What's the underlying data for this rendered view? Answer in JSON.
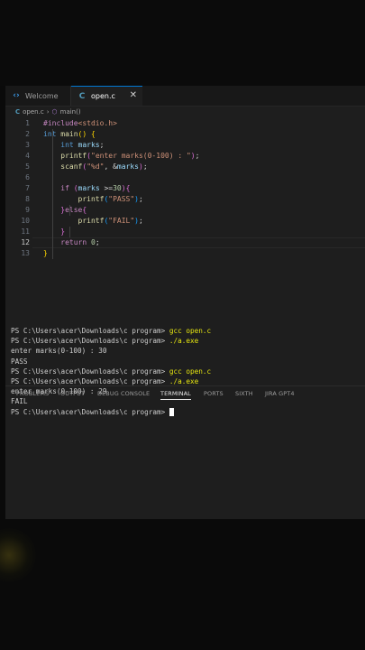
{
  "tabs": [
    {
      "label": "Welcome",
      "icon": "vscode-icon"
    },
    {
      "label": "open.c",
      "icon": "c-file-icon",
      "active": true
    }
  ],
  "breadcrumb": {
    "file": "open.c",
    "symbol": "main()"
  },
  "code_lines": [
    {
      "n": "1",
      "tokens": [
        [
          "#include",
          "k-pink"
        ],
        [
          "<stdio.h>",
          "k-str"
        ]
      ]
    },
    {
      "n": "2",
      "tokens": [
        [
          "int ",
          "k-blue"
        ],
        [
          "main",
          "k-yel"
        ],
        [
          "() ",
          "b1"
        ],
        [
          "{",
          "b1"
        ]
      ]
    },
    {
      "n": "3",
      "tokens": [
        [
          "    "
        ],
        [
          "int ",
          "k-blue"
        ],
        [
          "marks",
          "k-var"
        ],
        [
          ";",
          "k-punc"
        ]
      ]
    },
    {
      "n": "4",
      "tokens": [
        [
          "    "
        ],
        [
          "printf",
          "k-yel"
        ],
        [
          "(",
          "b2"
        ],
        [
          "\"enter marks(0-100) : \"",
          "k-str"
        ],
        [
          ")",
          "b2"
        ],
        [
          ";",
          "k-punc"
        ]
      ]
    },
    {
      "n": "5",
      "tokens": [
        [
          "    "
        ],
        [
          "scanf",
          "k-yel"
        ],
        [
          "(",
          "b2"
        ],
        [
          "\"%d\"",
          "k-str"
        ],
        [
          ", &",
          "k-punc"
        ],
        [
          "marks",
          "k-var"
        ],
        [
          ")",
          "b2"
        ],
        [
          ";",
          "k-punc"
        ]
      ]
    },
    {
      "n": "6",
      "tokens": []
    },
    {
      "n": "7",
      "tokens": [
        [
          "    "
        ],
        [
          "if ",
          "k-pink"
        ],
        [
          "(",
          "b2"
        ],
        [
          "marks ",
          "k-var"
        ],
        [
          ">=",
          "k-punc"
        ],
        [
          "30",
          "k-num"
        ],
        [
          ")",
          "b2"
        ],
        [
          "{",
          "b2"
        ]
      ]
    },
    {
      "n": "8",
      "tokens": [
        [
          "        "
        ],
        [
          "printf",
          "k-yel"
        ],
        [
          "(",
          "b3"
        ],
        [
          "\"PASS\"",
          "k-str"
        ],
        [
          ")",
          "b3"
        ],
        [
          ";",
          "k-punc"
        ]
      ]
    },
    {
      "n": "9",
      "tokens": [
        [
          "    "
        ],
        [
          "}",
          "b2"
        ],
        [
          "else",
          "k-pink"
        ],
        [
          "{",
          "b2"
        ]
      ]
    },
    {
      "n": "10",
      "tokens": [
        [
          "        "
        ],
        [
          "printf",
          "k-yel"
        ],
        [
          "(",
          "b3"
        ],
        [
          "\"FAIL\"",
          "k-str"
        ],
        [
          ")",
          "b3"
        ],
        [
          ";",
          "k-punc"
        ]
      ]
    },
    {
      "n": "11",
      "tokens": [
        [
          "    "
        ],
        [
          "}",
          "b2"
        ]
      ]
    },
    {
      "n": "12",
      "tokens": [
        [
          "    "
        ],
        [
          "return ",
          "k-pink"
        ],
        [
          "0",
          "k-num"
        ],
        [
          ";",
          "k-punc"
        ]
      ],
      "active": true
    },
    {
      "n": "13",
      "tokens": [
        [
          "}",
          "b1"
        ]
      ]
    }
  ],
  "panel_tabs": [
    "PROBLEMS",
    "OUTPUT",
    "DEBUG CONSOLE",
    "TERMINAL",
    "PORTS",
    "SIXTH",
    "JIRA GPT4"
  ],
  "active_panel_tab": "TERMINAL",
  "terminal": {
    "prompt": "PS C:\\Users\\acer\\Downloads\\c program> ",
    "lines": [
      {
        "type": "cmd",
        "cmd": "gcc open.c"
      },
      {
        "type": "cmd",
        "cmd": "./a.exe"
      },
      {
        "type": "out",
        "text": "enter marks(0-100) : 30"
      },
      {
        "type": "out",
        "text": "PASS"
      },
      {
        "type": "cmd",
        "cmd": "gcc open.c"
      },
      {
        "type": "cmd",
        "cmd": "./a.exe"
      },
      {
        "type": "out",
        "text": "enter marks(0-100) : 29"
      },
      {
        "type": "out",
        "text": "FAIL"
      },
      {
        "type": "cmd",
        "cmd": "",
        "cursor": true
      }
    ]
  },
  "colors": {
    "editor_bg": "#1e1e1e",
    "active_tab_border": "#0078d4",
    "terminal_cmd": "#e5e510"
  }
}
